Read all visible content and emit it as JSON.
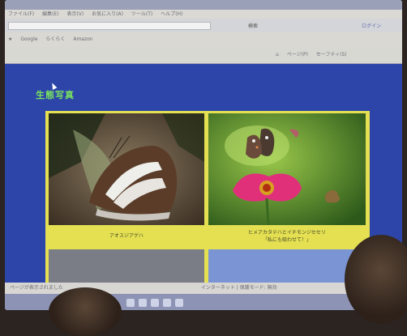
{
  "browser": {
    "title": "",
    "menu_items": [
      "ファイル(F)",
      "編集(E)",
      "表示(V)",
      "お気に入り(A)",
      "ツール(T)",
      "ヘルプ(H)"
    ],
    "search": {
      "value": "",
      "placeholder": "",
      "button_label": "検索",
      "login_label": "ログイン"
    },
    "bookmarks": [
      "Google",
      "らくらく",
      "Amazon"
    ],
    "toolbar_items": [
      "ページ(P)",
      "セーフティ(S)"
    ],
    "status_left": "ページが表示されました",
    "status_right": "インターネット | 保護モード: 無効"
  },
  "page": {
    "heading": "生態写真",
    "photos": [
      {
        "caption_lines": [
          "アオスジアゲハ"
        ]
      },
      {
        "caption_lines": [
          "ヒメアカタテハとイチモンジセセリ",
          "「私にも吸わせて！」"
        ]
      }
    ]
  },
  "colors": {
    "page_background": "#2d45a8",
    "heading": "#78e060",
    "grid_border": "#e4e052"
  }
}
